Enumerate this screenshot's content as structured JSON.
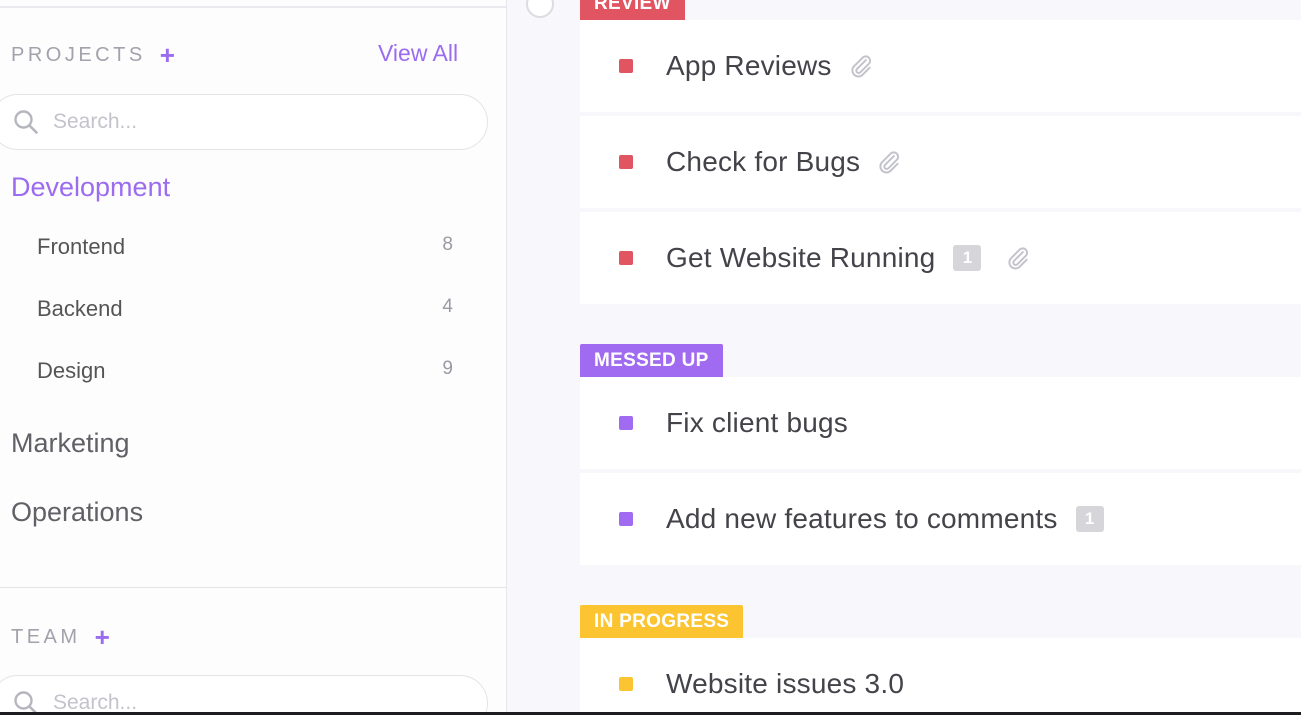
{
  "sidebar": {
    "projects_title": "PROJECTS",
    "add_symbol": "+",
    "view_all": "View All",
    "search_placeholder": "Search...",
    "projects": [
      {
        "name": "Development",
        "active": true,
        "children": [
          {
            "name": "Frontend",
            "count": "8"
          },
          {
            "name": "Backend",
            "count": "4"
          },
          {
            "name": "Design",
            "count": "9"
          }
        ]
      },
      {
        "name": "Marketing"
      },
      {
        "name": "Operations"
      }
    ],
    "team_title": "TEAM",
    "team_search_placeholder": "Search..."
  },
  "main": {
    "groups": [
      {
        "status": "REVIEW",
        "color": "#e05561",
        "tasks": [
          {
            "name": "App Reviews",
            "attachment": true
          },
          {
            "name": "Check for Bugs",
            "attachment": true
          },
          {
            "name": "Get Website Running",
            "badge": "1",
            "attachment": true
          }
        ]
      },
      {
        "status": "MESSED UP",
        "color": "#a06bf0",
        "tasks": [
          {
            "name": "Fix client bugs"
          },
          {
            "name": "Add new features to comments",
            "badge": "1"
          }
        ]
      },
      {
        "status": "IN PROGRESS",
        "color": "#fbc430",
        "tasks": [
          {
            "name": "Website issues 3.0"
          }
        ]
      }
    ],
    "icons": {
      "attachment": "paperclip-icon",
      "search": "search-icon"
    }
  }
}
